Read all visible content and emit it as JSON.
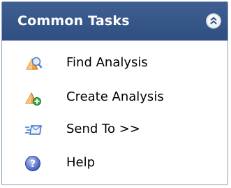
{
  "panel": {
    "title": "Common Tasks",
    "collapse_icon": "double-chevron-up-icon"
  },
  "items": [
    {
      "label": "Find Analysis",
      "icon": "find-analysis-icon"
    },
    {
      "label": "Create Analysis",
      "icon": "create-analysis-icon"
    },
    {
      "label": "Send To >>",
      "icon": "send-to-icon"
    },
    {
      "label": "Help",
      "icon": "help-icon"
    }
  ],
  "colors": {
    "header": "#2f4f82",
    "border": "#8a9bb4"
  }
}
